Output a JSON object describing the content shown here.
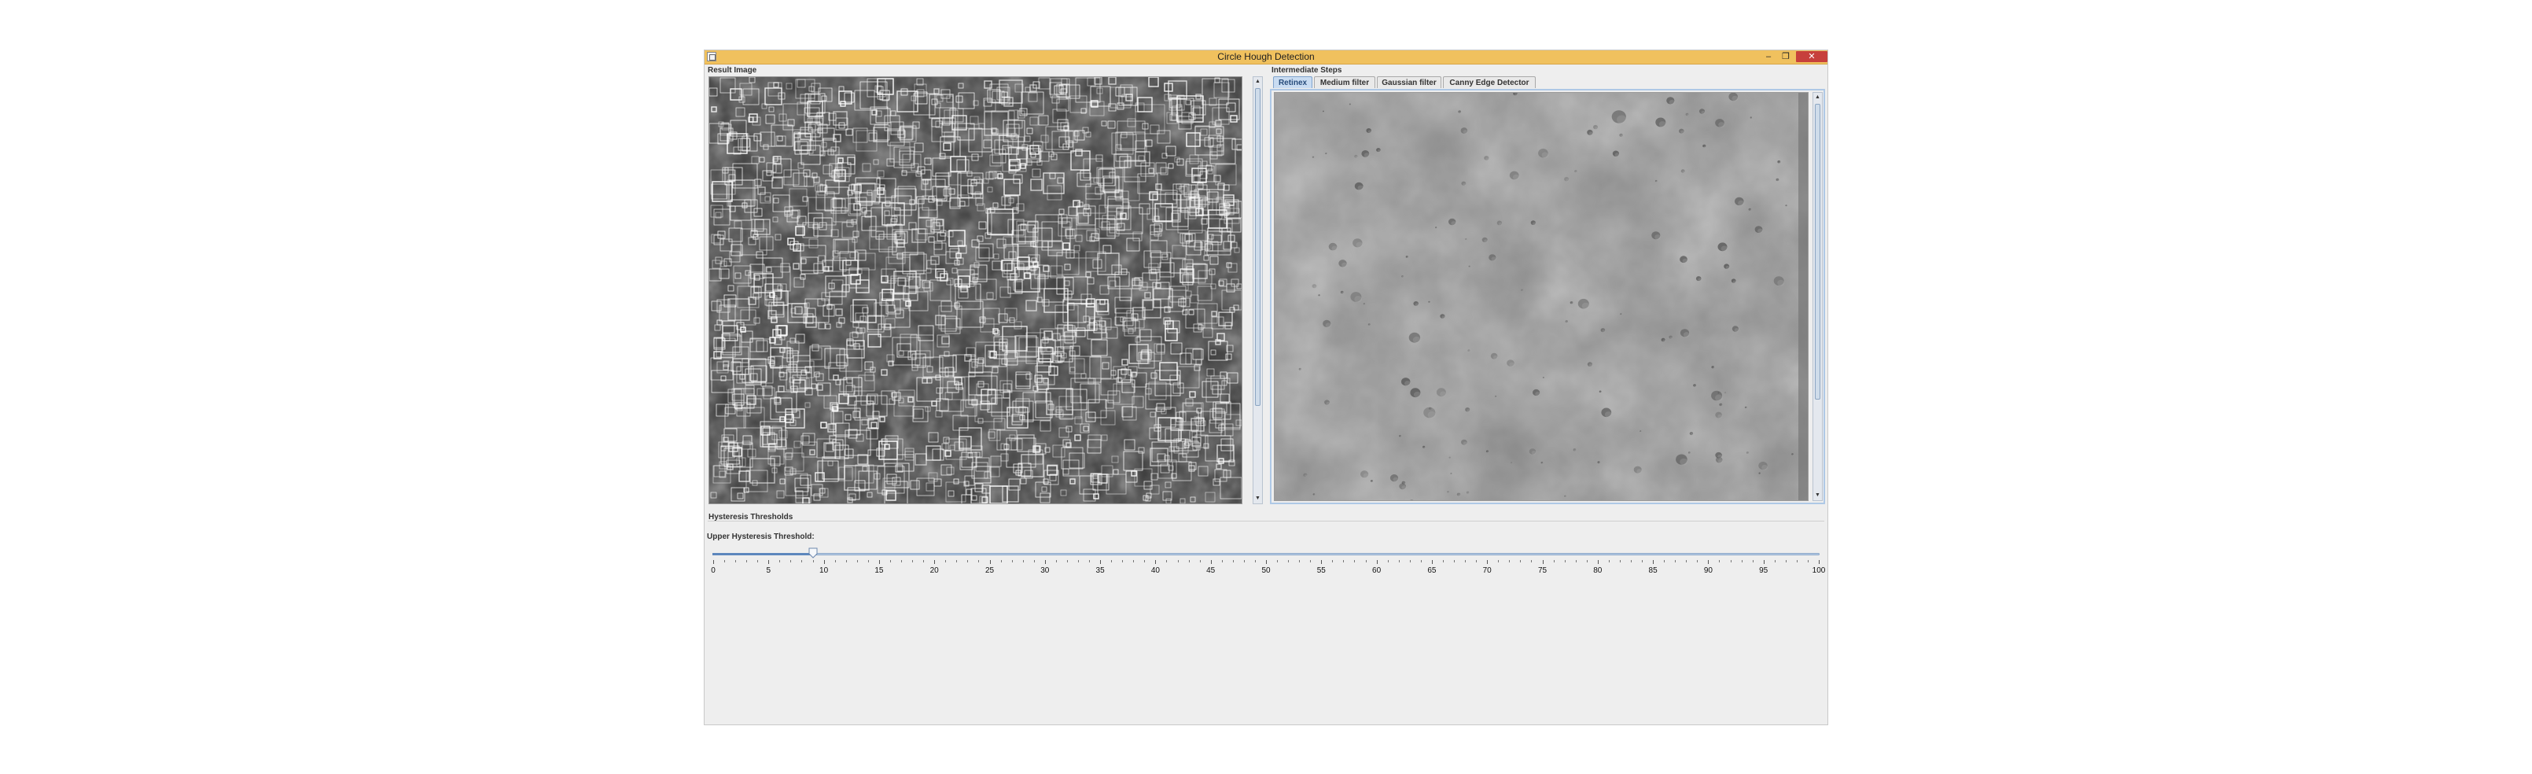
{
  "window": {
    "title": "Circle Hough Detection",
    "controls": {
      "minimize": "–",
      "maximize": "❐",
      "close": "✕"
    }
  },
  "left_panel": {
    "label": "Result Image",
    "image_description_icon": "result-image"
  },
  "right_panel": {
    "label": "Intermediate Steps",
    "tabs": [
      {
        "label": "Retinex",
        "active": true
      },
      {
        "label": "Medium filter",
        "active": false
      },
      {
        "label": "Gaussian filter",
        "active": false
      },
      {
        "label": "Canny Edge Detector",
        "active": false
      }
    ]
  },
  "hysteresis": {
    "section_title": "Hysteresis Thresholds",
    "upper_label": "Upper Hysteresis Threshold:",
    "slider": {
      "min": 0,
      "max": 100,
      "value": 9,
      "major_step": 5,
      "minor_step": 1
    },
    "tick_labels": [
      "0",
      "5",
      "10",
      "15",
      "20",
      "25",
      "30",
      "35",
      "40",
      "45",
      "50",
      "55",
      "60",
      "65",
      "70",
      "75",
      "80",
      "85",
      "90",
      "95",
      "100"
    ]
  },
  "colors": {
    "titlebar": "#f0c15e",
    "close_button": "#c7403c",
    "accent": "#5d87bd"
  }
}
